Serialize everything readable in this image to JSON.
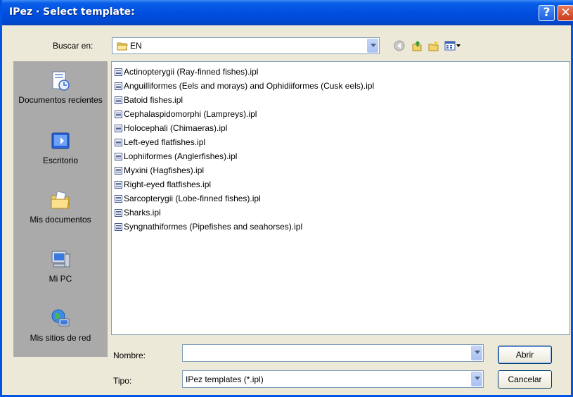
{
  "window": {
    "title": "IPez · Select template:"
  },
  "lookin": {
    "label": "Buscar en:",
    "value": "EN",
    "folder_icon": "folder-open-icon"
  },
  "toolbar": {
    "icons": [
      "back-icon",
      "up-folder-icon",
      "new-folder-icon",
      "view-menu-icon"
    ]
  },
  "places": [
    {
      "label": "Documentos recientes",
      "icon": "recent-documents-icon"
    },
    {
      "label": "Escritorio",
      "icon": "desktop-icon"
    },
    {
      "label": "Mis documentos",
      "icon": "my-documents-icon"
    },
    {
      "label": "Mi PC",
      "icon": "my-computer-icon"
    },
    {
      "label": "Mis sitios de red",
      "icon": "network-places-icon"
    }
  ],
  "files": [
    "Actinopterygii (Ray-finned fishes).ipl",
    "Anguilliformes (Eels and morays) and Ophidiiformes (Cusk eels).ipl",
    "Batoid fishes.ipl",
    "Cephalaspidomorphi (Lampreys).ipl",
    "Holocephali (Chimaeras).ipl",
    "Left-eyed flatfishes.ipl",
    "Lophiiformes (Anglerfishes).ipl",
    "Myxini (Hagfishes).ipl",
    "Right-eyed flatfishes.ipl",
    "Sarcopterygii (Lobe-finned fishes).ipl",
    "Sharks.ipl",
    "Syngnathiformes (Pipefishes and seahorses).ipl"
  ],
  "filename": {
    "label": "Nombre:",
    "value": ""
  },
  "filetype": {
    "label": "Tipo:",
    "value": "IPez templates (*.ipl)"
  },
  "buttons": {
    "open": "Abrir",
    "cancel": "Cancelar"
  },
  "colors": {
    "titlebar": "#0050e0",
    "window_bg": "#ece9d8",
    "places_bg": "#aaaaaa"
  }
}
